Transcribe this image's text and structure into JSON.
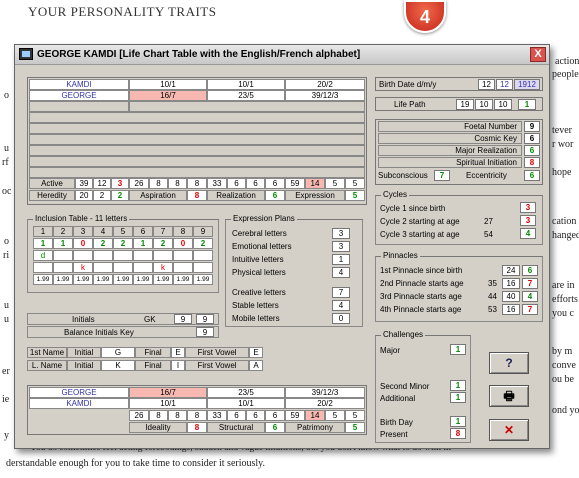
{
  "background": {
    "title": "YOUR PERSONALITY TRAITS",
    "right_text": [
      "action",
      "people",
      "tever",
      "r wor",
      "hope",
      "cation",
      "hanged",
      "are in",
      "efforts",
      "you c",
      "by m",
      "conve",
      "ou be",
      "ond yo"
    ],
    "left_letters": [
      "o",
      "u",
      "rf",
      "oc",
      "o",
      "ri",
      "u",
      "u",
      "er",
      "ie",
      "y"
    ],
    "bottom_line1": "You do sometimes feel acting forebodings, sudden and vague intuitions, but you don't know what to do with th",
    "bottom_line2": "derstandable enough for you to take time to consider it seriously."
  },
  "badge": "4",
  "window": {
    "title": "GEORGE KAMDI [Life Chart Table with the English/French alphabet]",
    "close": "X"
  },
  "chart": {
    "names": [
      "KAMDI",
      "GEORGE"
    ],
    "cols": [
      [
        "10/1",
        "16/7"
      ],
      [
        "10/1",
        "23/5"
      ],
      [
        "20/2",
        "39/12/3"
      ]
    ],
    "active": {
      "label": "Active",
      "v": [
        "39",
        "12",
        "3",
        "26",
        "8",
        "8",
        "8",
        "33",
        "6",
        "6",
        "6",
        "59",
        "14",
        "5",
        "5"
      ]
    },
    "heredity": {
      "label": "Heredity",
      "v1": "20",
      "v2": "2",
      "v3": "2"
    },
    "aspiration": {
      "label": "Aspiration",
      "v": "8"
    },
    "realization": {
      "label": "Realization",
      "v": "6"
    },
    "expression": {
      "label": "Expression",
      "v": "5"
    }
  },
  "birth": {
    "label": "Birth Date d/m/y",
    "d": "12",
    "m": "12",
    "y": "1912"
  },
  "lifepath": {
    "label": "Life Path",
    "a": "19",
    "b": "10",
    "c": "10",
    "d": "1"
  },
  "numbers": [
    {
      "label": "Foetal Number",
      "v": "9"
    },
    {
      "label": "Cosmic Key",
      "v": "6"
    },
    {
      "label": "Major Realization",
      "v": "6"
    },
    {
      "label": "Spiritual Initiation",
      "v": "8"
    }
  ],
  "subconscious": {
    "label": "Subconscious",
    "v": "7",
    "label2": "Eccentricity",
    "v2": "6"
  },
  "cycles": {
    "legend": "Cycles",
    "items": [
      {
        "label": "Cycle 1 since birth",
        "age": "",
        "v": "3"
      },
      {
        "label": "Cycle 2 starting at age",
        "age": "27",
        "v": "3"
      },
      {
        "label": "Cycle 3 starting at age",
        "age": "54",
        "v": "4"
      }
    ]
  },
  "inclusion": {
    "legend": "Inclusion Table - 11 letters",
    "head": [
      "1",
      "2",
      "3",
      "4",
      "5",
      "6",
      "7",
      "8",
      "9"
    ],
    "counts": [
      "1",
      "1",
      "0",
      "2",
      "2",
      "1",
      "2",
      "0",
      "2"
    ],
    "row3": [
      "d",
      "",
      "",
      "",
      "",
      "",
      "",
      "",
      ""
    ],
    "row4": [
      "",
      "",
      "k",
      "",
      "",
      "",
      "k",
      "",
      ""
    ],
    "row5": [
      "1.99",
      "1.99",
      "1.99",
      "1.99",
      "1.99",
      "1.99",
      "1.99",
      "1.99",
      "1.99"
    ]
  },
  "initials": {
    "label": "Initials",
    "a": "GK",
    "b": "9",
    "c": "9",
    "key_label": "Balance Initials Key",
    "key": "9"
  },
  "expplans": {
    "legend": "Expression Plans",
    "items": [
      {
        "label": "Cerebral letters",
        "v": "3"
      },
      {
        "label": "Emotional letters",
        "v": "3"
      },
      {
        "label": "Intuitive letters",
        "v": "1"
      },
      {
        "label": "Physical letters",
        "v": "4"
      },
      {
        "label": "Creative letters",
        "v": "7"
      },
      {
        "label": "Stable letters",
        "v": "4"
      },
      {
        "label": "Mobile letters",
        "v": "0"
      }
    ]
  },
  "pinnacles": {
    "legend": "Pinnacles",
    "items": [
      {
        "label": "1st Pinnacle since birth",
        "age": "",
        "a": "24",
        "b": "6"
      },
      {
        "label": "2nd Pinnacle starts age",
        "age": "35",
        "a": "16",
        "b": "7"
      },
      {
        "label": "3rd Pinnacle starts age",
        "age": "44",
        "a": "40",
        "b": "4"
      },
      {
        "label": "4th Pinnacle starts age",
        "age": "53",
        "a": "16",
        "b": "7"
      }
    ]
  },
  "firstname": {
    "c1": "1st Name",
    "c2": "Initial",
    "c3": "G",
    "c4": "Final",
    "c5": "E",
    "c6": "First Vowel",
    "c7": "E"
  },
  "lastname": {
    "c1": "L. Name",
    "c2": "Initial",
    "c3": "K",
    "c4": "Final",
    "c5": "I",
    "c6": "First Vowel",
    "c7": "A"
  },
  "bottom": {
    "names": [
      "GEORGE",
      "KAMDI"
    ],
    "cols": [
      [
        "16/7",
        "10/1"
      ],
      [
        "23/5",
        "10/1"
      ],
      [
        "39/12/3",
        "20/2"
      ]
    ],
    "nums": [
      "26",
      "8",
      "8",
      "8",
      "33",
      "6",
      "6",
      "6",
      "59",
      "14",
      "5",
      "5"
    ],
    "ideality": {
      "label": "Ideality",
      "v": "8"
    },
    "structural": {
      "label": "Structural",
      "v": "6"
    },
    "patrimony": {
      "label": "Patrimony",
      "v": "5"
    }
  },
  "challenges": {
    "legend": "Challenges",
    "major": {
      "label": "Major",
      "v": "1"
    },
    "second": {
      "label": "Second Minor",
      "v": "1"
    },
    "additional": {
      "label": "Additional",
      "v": "1"
    },
    "birthday": {
      "label": "Birth Day",
      "v": "1"
    },
    "present": {
      "label": "Present",
      "v": "8"
    }
  },
  "buttons": {
    "help": "?",
    "print": "🖶",
    "close": "✕"
  }
}
